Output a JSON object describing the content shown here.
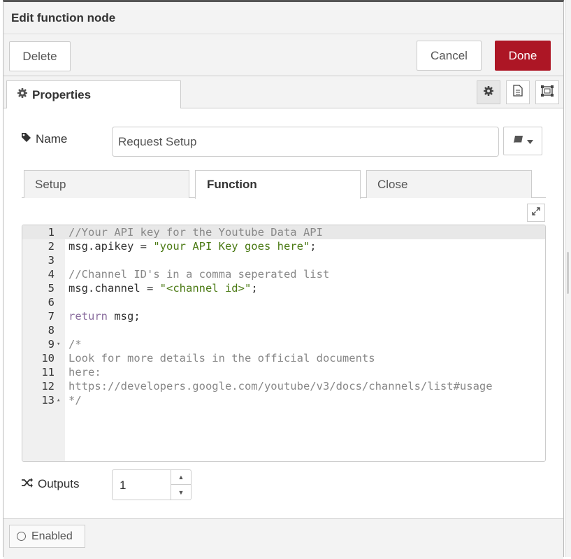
{
  "dialog": {
    "title": "Edit function node"
  },
  "toolbar": {
    "delete_label": "Delete",
    "cancel_label": "Cancel",
    "done_label": "Done"
  },
  "tabs": {
    "properties_label": "Properties"
  },
  "form": {
    "name_label": "Name",
    "name_value": "Request Setup",
    "outputs_label": "Outputs",
    "outputs_value": "1"
  },
  "subtabs": [
    {
      "label": "Setup",
      "active": false
    },
    {
      "label": "Function",
      "active": true
    },
    {
      "label": "Close",
      "active": false
    }
  ],
  "editor": {
    "active_line": 1,
    "lines": [
      {
        "n": "1",
        "text": "//Your API key for the Youtube Data API",
        "kind": "comment"
      },
      {
        "n": "2",
        "text": "msg.apikey = \"your API Key goes here\";",
        "kind": "assign"
      },
      {
        "n": "3",
        "text": "",
        "kind": "plain"
      },
      {
        "n": "4",
        "text": "//Channel ID's in a comma seperated list",
        "kind": "comment"
      },
      {
        "n": "5",
        "text": "msg.channel = \"<channel id>\";",
        "kind": "assign"
      },
      {
        "n": "6",
        "text": "",
        "kind": "plain"
      },
      {
        "n": "7",
        "text": "return msg;",
        "kind": "return"
      },
      {
        "n": "8",
        "text": "",
        "kind": "plain"
      },
      {
        "n": "9",
        "text": "/*",
        "kind": "comment",
        "fold": "▾"
      },
      {
        "n": "10",
        "text": "Look for more details in the official documents",
        "kind": "comment"
      },
      {
        "n": "11",
        "text": "here:",
        "kind": "comment"
      },
      {
        "n": "12",
        "text": "https://developers.google.com/youtube/v3/docs/channels/list#usage",
        "kind": "comment"
      },
      {
        "n": "13",
        "text": "*/",
        "kind": "comment",
        "fold": "▴"
      }
    ]
  },
  "footer": {
    "enabled_label": "Enabled"
  },
  "colors": {
    "done": "#ad1625",
    "comment": "#888888",
    "string": "#4b7a14",
    "keyword": "#8a6d9e"
  },
  "icons": [
    "gear-icon",
    "description-icon",
    "appearance-icon",
    "tag-icon",
    "book-icon",
    "expand-icon",
    "shuffle-icon",
    "circle-icon"
  ]
}
